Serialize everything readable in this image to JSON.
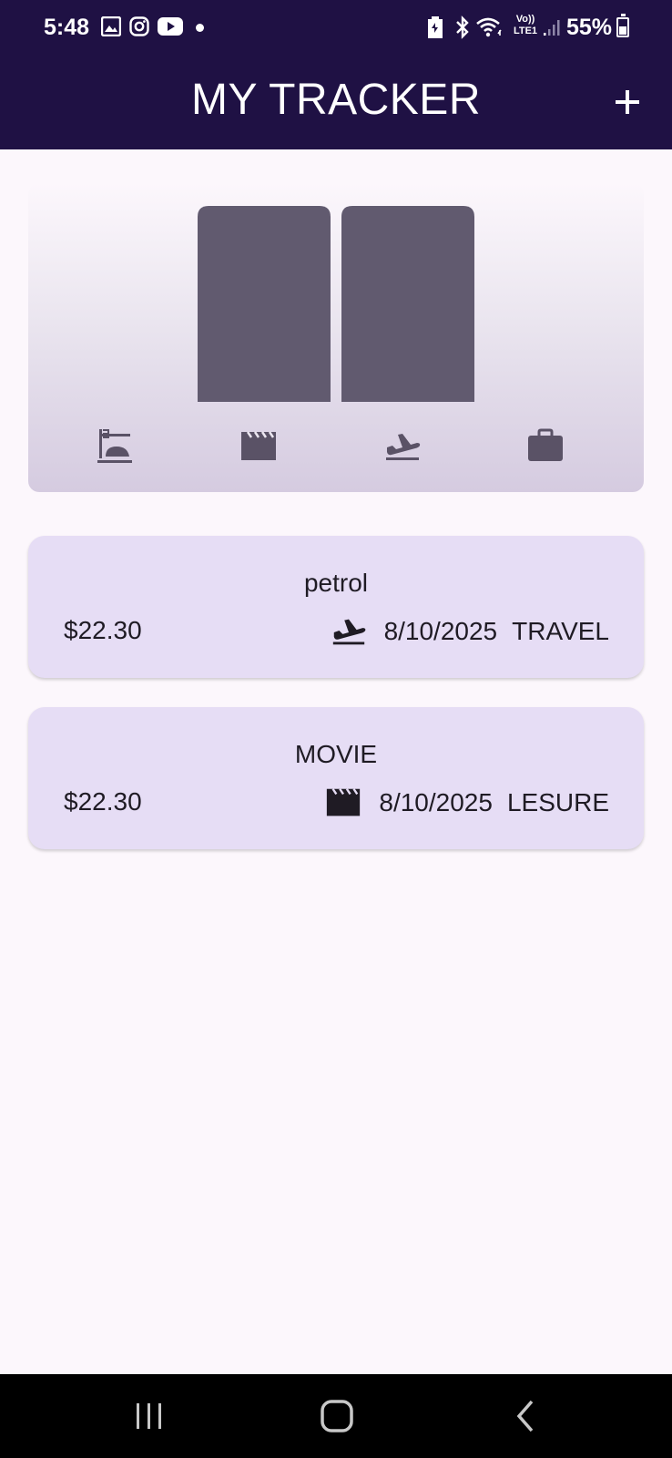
{
  "status_bar": {
    "time": "5:48",
    "battery": "55%",
    "left_icons": [
      "gallery-icon",
      "instagram-icon",
      "youtube-icon",
      "notification-dot"
    ],
    "right_icons": [
      "battery-saver-icon",
      "bluetooth-icon",
      "wifi-icon",
      "volte-lte-icon",
      "signal-icon",
      "battery-icon"
    ],
    "network_label_top": "Vo))",
    "network_label_bottom": "LTE1"
  },
  "app_bar": {
    "title": "MY TRACKER",
    "add_icon": "plus-icon"
  },
  "chart": {
    "type": "bar",
    "bar_color": "#615a6f",
    "categories": [
      "food",
      "leisure",
      "travel",
      "work"
    ],
    "category_icons": [
      "dinner-icon",
      "movie-clapper-icon",
      "flight-takeoff-icon",
      "briefcase-icon"
    ],
    "values": [
      0,
      1,
      1,
      0
    ]
  },
  "expenses": [
    {
      "title": "petrol",
      "amount": "$22.30",
      "date": "8/10/2025",
      "category": "TRAVEL",
      "icon": "flight-takeoff-icon"
    },
    {
      "title": "MOVIE",
      "amount": "$22.30",
      "date": "8/10/2025",
      "category": "LESURE",
      "icon": "movie-clapper-icon"
    }
  ],
  "nav_bar": {
    "buttons": [
      "recent-apps-icon",
      "home-icon",
      "back-icon"
    ]
  },
  "colors": {
    "app_bar_bg": "#1f1144",
    "background": "#fcf7fc",
    "card_bg": "#e6ddf5",
    "icon_dark": "#1f1b24",
    "chart_icon": "#5a5266"
  }
}
